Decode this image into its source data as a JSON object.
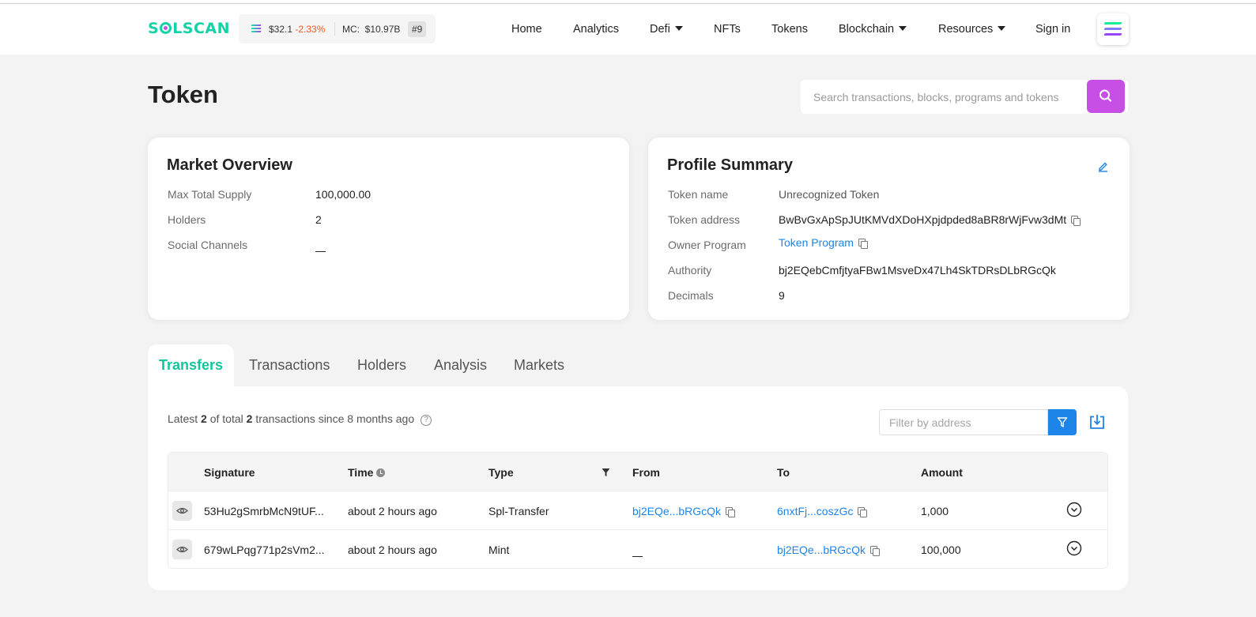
{
  "header": {
    "logo_before": "S",
    "logo_after": "LSCAN",
    "price": "$32.1",
    "change": "-2.33%",
    "mc_label": "MC:",
    "mc_value": "$10.97B",
    "rank": "#9",
    "nav": {
      "home": "Home",
      "analytics": "Analytics",
      "defi": "Defi",
      "nfts": "NFTs",
      "tokens": "Tokens",
      "blockchain": "Blockchain",
      "resources": "Resources",
      "signin": "Sign in"
    }
  },
  "page": {
    "title": "Token",
    "search_placeholder": "Search transactions, blocks, programs and tokens"
  },
  "market": {
    "title": "Market Overview",
    "max_supply_label": "Max Total Supply",
    "max_supply": "100,000.00",
    "holders_label": "Holders",
    "holders": "2",
    "social_label": "Social Channels"
  },
  "profile": {
    "title": "Profile Summary",
    "name_label": "Token name",
    "name": "Unrecognized Token",
    "address_label": "Token address",
    "address": "BwBvGxApSpJUtKMVdXDoHXpjdpded8aBR8rWjFvw3dMt",
    "owner_label": "Owner Program",
    "owner": "Token Program",
    "authority_label": "Authority",
    "authority": "bj2EQebCmfjtyaFBw1MsveDx47Lh4SkTDRsDLbRGcQk",
    "decimals_label": "Decimals",
    "decimals": "9"
  },
  "tabs": {
    "transfers": "Transfers",
    "transactions": "Transactions",
    "holders": "Holders",
    "analysis": "Analysis",
    "markets": "Markets"
  },
  "transfers": {
    "summary_pre": "Latest ",
    "latest": "2",
    "summary_mid": " of total ",
    "total": "2",
    "summary_post": " transactions since 8 months ago",
    "filter_placeholder": "Filter by address",
    "columns": {
      "signature": "Signature",
      "time": "Time",
      "type": "Type",
      "from": "From",
      "to": "To",
      "amount": "Amount"
    },
    "rows": [
      {
        "signature": "53Hu2gSmrbMcN9tUF...",
        "time": "about 2 hours ago",
        "type": "Spl-Transfer",
        "from": "bj2EQe...bRGcQk",
        "to": "6nxtFj...coszGc",
        "amount": "1,000"
      },
      {
        "signature": "679wLPqg771p2sVm2...",
        "time": "about 2 hours ago",
        "type": "Mint",
        "to": "bj2EQe...bRGcQk",
        "amount": "100,000"
      }
    ]
  },
  "colors": {
    "brand_green": "#14d2a8",
    "accent_purple": "#c84fe6",
    "link_blue": "#1d84e8",
    "negative": "#ef5a2a"
  }
}
